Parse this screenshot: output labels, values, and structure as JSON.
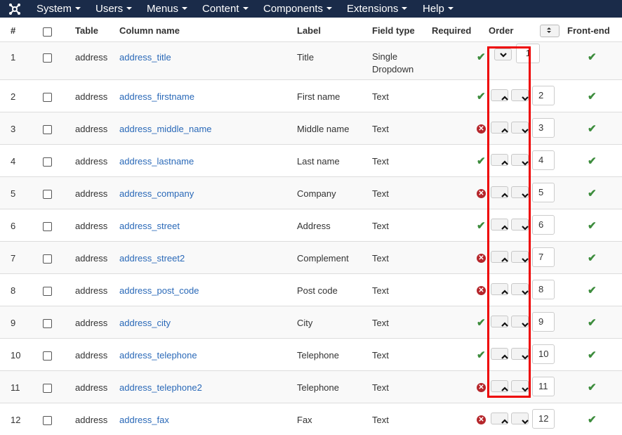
{
  "nav": {
    "items": [
      {
        "label": "System"
      },
      {
        "label": "Users"
      },
      {
        "label": "Menus"
      },
      {
        "label": "Content"
      },
      {
        "label": "Components"
      },
      {
        "label": "Extensions"
      },
      {
        "label": "Help"
      }
    ]
  },
  "table": {
    "headers": {
      "num": "#",
      "table": "Table",
      "column": "Column name",
      "label": "Label",
      "field_type": "Field type",
      "required": "Required",
      "order": "Order",
      "frontend": "Front-end"
    },
    "rows": [
      {
        "num": "1",
        "table": "address",
        "column": "address_title",
        "label": "Title",
        "field_type": "Single\nDropdown",
        "required": true,
        "order": "1",
        "frontend": true
      },
      {
        "num": "2",
        "table": "address",
        "column": "address_firstname",
        "label": "First name",
        "field_type": "Text",
        "required": true,
        "order": "2",
        "frontend": true
      },
      {
        "num": "3",
        "table": "address",
        "column": "address_middle_name",
        "label": "Middle name",
        "field_type": "Text",
        "required": false,
        "order": "3",
        "frontend": true
      },
      {
        "num": "4",
        "table": "address",
        "column": "address_lastname",
        "label": "Last name",
        "field_type": "Text",
        "required": true,
        "order": "4",
        "frontend": true
      },
      {
        "num": "5",
        "table": "address",
        "column": "address_company",
        "label": "Company",
        "field_type": "Text",
        "required": false,
        "order": "5",
        "frontend": true
      },
      {
        "num": "6",
        "table": "address",
        "column": "address_street",
        "label": "Address",
        "field_type": "Text",
        "required": true,
        "order": "6",
        "frontend": true
      },
      {
        "num": "7",
        "table": "address",
        "column": "address_street2",
        "label": "Complement",
        "field_type": "Text",
        "required": false,
        "order": "7",
        "frontend": true
      },
      {
        "num": "8",
        "table": "address",
        "column": "address_post_code",
        "label": "Post code",
        "field_type": "Text",
        "required": false,
        "order": "8",
        "frontend": true
      },
      {
        "num": "9",
        "table": "address",
        "column": "address_city",
        "label": "City",
        "field_type": "Text",
        "required": true,
        "order": "9",
        "frontend": true
      },
      {
        "num": "10",
        "table": "address",
        "column": "address_telephone",
        "label": "Telephone",
        "field_type": "Text",
        "required": true,
        "order": "10",
        "frontend": true
      },
      {
        "num": "11",
        "table": "address",
        "column": "address_telephone2",
        "label": "Telephone",
        "field_type": "Text",
        "required": false,
        "order": "11",
        "frontend": true
      },
      {
        "num": "12",
        "table": "address",
        "column": "address_fax",
        "label": "Fax",
        "field_type": "Text",
        "required": false,
        "order": "12",
        "frontend": true
      }
    ]
  },
  "icons": {
    "logo": "joomla-logo-icon",
    "required_yes": "check-icon",
    "required_no": "cross-circle-icon",
    "order_up": "chevron-up-icon",
    "order_down": "chevron-down-icon",
    "sort": "sort-icon"
  },
  "colors": {
    "navbar": "#1a2b49",
    "link": "#2a69b8",
    "check": "#3c8c3c",
    "cross": "#b5262b",
    "highlight": "#e00000"
  }
}
